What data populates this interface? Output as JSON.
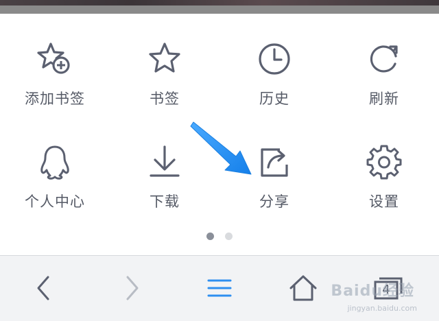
{
  "menu": {
    "items": [
      {
        "label": "添加书签",
        "icon": "star-plus-icon"
      },
      {
        "label": "书签",
        "icon": "star-icon"
      },
      {
        "label": "历史",
        "icon": "clock-icon"
      },
      {
        "label": "刷新",
        "icon": "refresh-icon"
      },
      {
        "label": "个人中心",
        "icon": "qq-penguin-icon"
      },
      {
        "label": "下载",
        "icon": "download-icon"
      },
      {
        "label": "分享",
        "icon": "share-icon"
      },
      {
        "label": "设置",
        "icon": "gear-icon"
      }
    ]
  },
  "pager": {
    "current_page": 1,
    "total_pages": 2
  },
  "toolbar": {
    "buttons": [
      {
        "name": "back",
        "icon": "chevron-left-icon"
      },
      {
        "name": "forward",
        "icon": "chevron-right-icon"
      },
      {
        "name": "menu",
        "icon": "menu-icon"
      },
      {
        "name": "home",
        "icon": "home-icon"
      },
      {
        "name": "tabs",
        "icon": "tabs-icon"
      }
    ],
    "tab_count": "4"
  },
  "watermark": {
    "brand": "Baidu经验",
    "url": "jingyan.baidu.com"
  },
  "colors": {
    "icon": "#5b6070",
    "label": "#555a66",
    "accent": "#2f8ff0",
    "arrow": "#1e8ef5",
    "toolbar_bg": "#f2f3f5",
    "dot_active": "#8a8f99",
    "dot_inactive": "#d9dbde"
  }
}
